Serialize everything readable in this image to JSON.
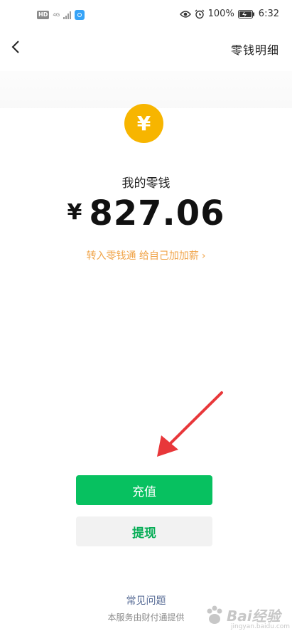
{
  "status_bar": {
    "hd": "HD",
    "network": "4G",
    "battery_percent": "100%",
    "time": "6:32"
  },
  "nav": {
    "detail_link": "零钱明细"
  },
  "wallet": {
    "coin_symbol": "¥",
    "label": "我的零钱",
    "currency": "¥",
    "amount": "827.06",
    "promo": "转入零钱通 给自己加加薪",
    "promo_chevron": "›"
  },
  "actions": {
    "recharge": "充值",
    "withdraw": "提现"
  },
  "footer": {
    "faq": "常见问题",
    "provider": "本服务由财付通提供"
  },
  "watermark": {
    "text": "Bai经验",
    "sub": "jingyan.baidu.com"
  },
  "colors": {
    "primary_green": "#07c160",
    "coin_yellow": "#f7b500",
    "promo_orange": "#f0a347",
    "link_blue": "#576b95",
    "annotation_red": "#e8373a"
  }
}
